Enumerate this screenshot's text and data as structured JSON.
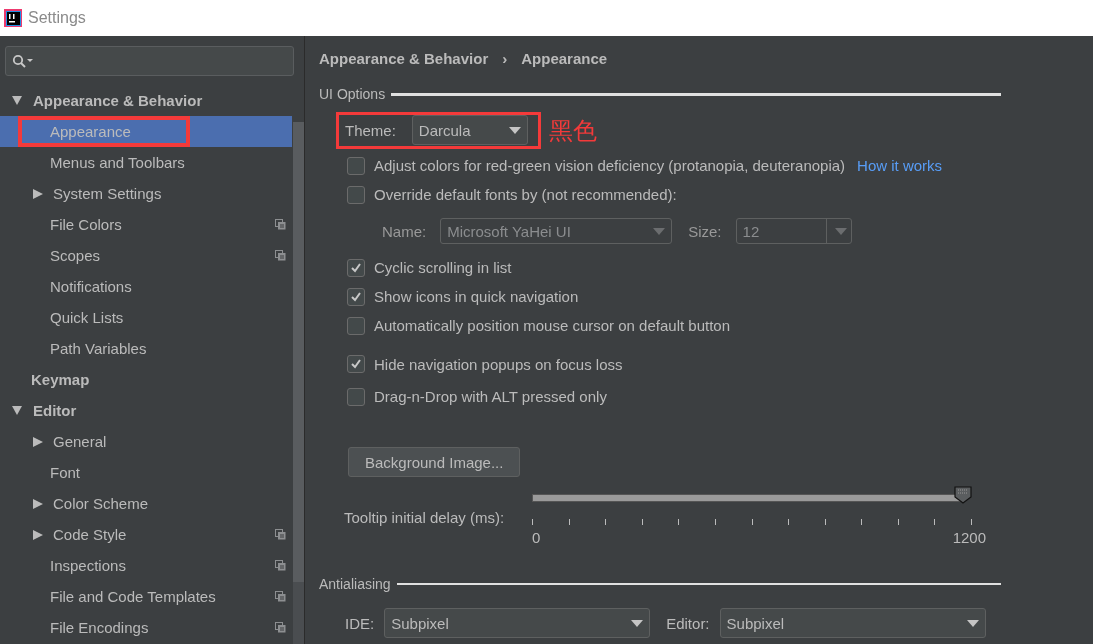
{
  "window": {
    "title": "Settings"
  },
  "sidebar": {
    "items": [
      {
        "label": "Appearance & Behavior",
        "expanded": true,
        "selected": false,
        "children": [
          {
            "label": "Appearance",
            "selected": true,
            "project_icon": false
          },
          {
            "label": "Menus and Toolbars",
            "selected": false,
            "project_icon": false
          },
          {
            "label": "System Settings",
            "expanded": false,
            "selected": false,
            "project_icon": false
          },
          {
            "label": "File Colors",
            "selected": false,
            "project_icon": true
          },
          {
            "label": "Scopes",
            "selected": false,
            "project_icon": true
          },
          {
            "label": "Notifications",
            "selected": false,
            "project_icon": false
          },
          {
            "label": "Quick Lists",
            "selected": false,
            "project_icon": false
          },
          {
            "label": "Path Variables",
            "selected": false,
            "project_icon": false
          }
        ]
      },
      {
        "label": "Keymap",
        "selected": false
      },
      {
        "label": "Editor",
        "expanded": true,
        "selected": false,
        "children": [
          {
            "label": "General",
            "expanded": false,
            "selected": false,
            "project_icon": false
          },
          {
            "label": "Font",
            "selected": false,
            "project_icon": false
          },
          {
            "label": "Color Scheme",
            "expanded": false,
            "selected": false,
            "project_icon": false
          },
          {
            "label": "Code Style",
            "expanded": false,
            "selected": false,
            "project_icon": true
          },
          {
            "label": "Inspections",
            "selected": false,
            "project_icon": true
          },
          {
            "label": "File and Code Templates",
            "selected": false,
            "project_icon": true
          },
          {
            "label": "File Encodings",
            "selected": false,
            "project_icon": true
          }
        ]
      }
    ]
  },
  "breadcrumb": [
    "Appearance & Behavior",
    "Appearance"
  ],
  "breadcrumb_separator": "›",
  "ui_options": {
    "title": "UI Options",
    "theme": {
      "label": "Theme:",
      "value": "Darcula"
    },
    "annotation": "黑色",
    "options": [
      {
        "kind": "checkbox",
        "label": "Adjust colors for red-green vision deficiency (protanopia, deuteranopia)",
        "checked": false,
        "link": "How it works"
      },
      {
        "kind": "checkbox",
        "label": "Override default fonts by (not recommended):",
        "checked": false
      },
      {
        "kind": "font",
        "name_label": "Name:",
        "name_value": "Microsoft YaHei UI",
        "size_label": "Size:",
        "size_value": "12",
        "disabled": true
      },
      {
        "kind": "checkbox",
        "label": "Cyclic scrolling in list",
        "checked": true
      },
      {
        "kind": "checkbox",
        "label": "Show icons in quick navigation",
        "checked": true
      },
      {
        "kind": "checkbox",
        "label": "Automatically position mouse cursor on default button",
        "checked": false
      },
      {
        "kind": "checkbox",
        "label": "Hide navigation popups on focus loss",
        "checked": true,
        "spaced": true
      },
      {
        "kind": "checkbox",
        "label": "Drag-n-Drop with ALT pressed only",
        "checked": false
      }
    ],
    "background_button": "Background Image...",
    "tooltip": {
      "label": "Tooltip initial delay (ms):",
      "level": 1,
      "min": "0",
      "max": "1200"
    }
  },
  "antialiasing": {
    "title": "Antialiasing",
    "ide_label": "IDE:",
    "ide_value": "Subpixel",
    "editor_label": "Editor:",
    "editor_value": "Subpixel"
  }
}
